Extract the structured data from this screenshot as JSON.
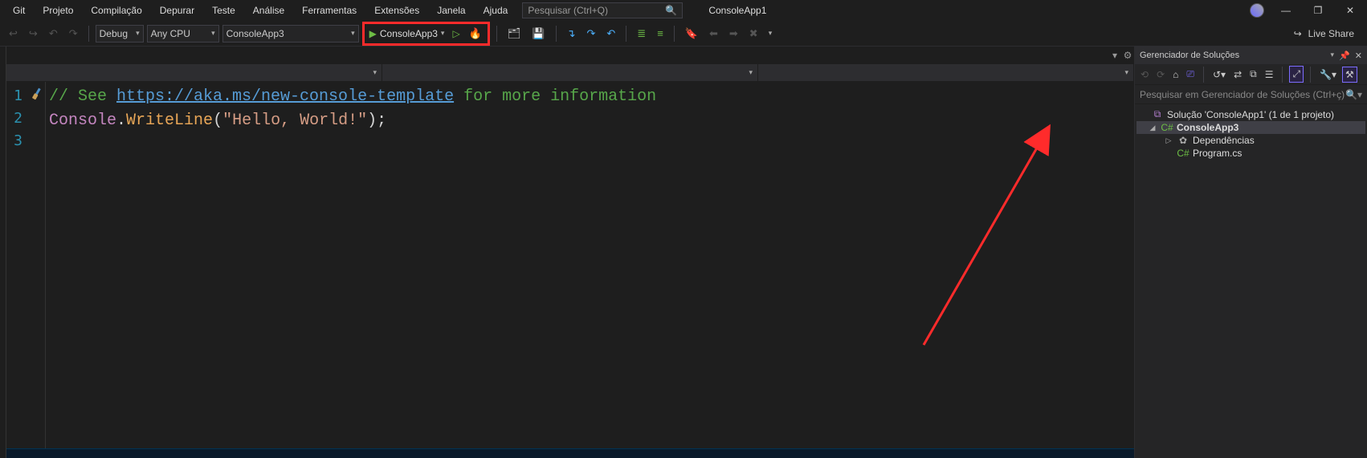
{
  "menubar": {
    "items": [
      "Git",
      "Projeto",
      "Compilação",
      "Depurar",
      "Teste",
      "Análise",
      "Ferramentas",
      "Extensões",
      "Janela",
      "Ajuda"
    ],
    "search_placeholder": "Pesquisar (Ctrl+Q)",
    "app_title": "ConsoleApp1"
  },
  "toolbar": {
    "config_label": "Debug",
    "platform_label": "Any CPU",
    "startup_label": "ConsoleApp3",
    "run_label": "ConsoleApp3",
    "liveshare_label": "Live Share"
  },
  "editor": {
    "line_numbers": [
      "1",
      "2",
      "3"
    ],
    "line1_prefix": "// See ",
    "line1_link": "https://aka.ms/new-console-template",
    "line1_suffix": " for more information",
    "line2_class": "Console",
    "line2_dot1": ".",
    "line2_method": "WriteLine",
    "line2_open": "(",
    "line2_string": "\"Hello, World!\"",
    "line2_close": ")",
    "line2_semi": ";"
  },
  "solution": {
    "panel_title": "Gerenciador de Soluções",
    "search_placeholder": "Pesquisar em Gerenciador de Soluções (Ctrl+ç)",
    "root_label": "Solução 'ConsoleApp1' (1 de 1 projeto)",
    "project_label": "ConsoleApp3",
    "deps_label": "Dependências",
    "file_label": "Program.cs"
  }
}
